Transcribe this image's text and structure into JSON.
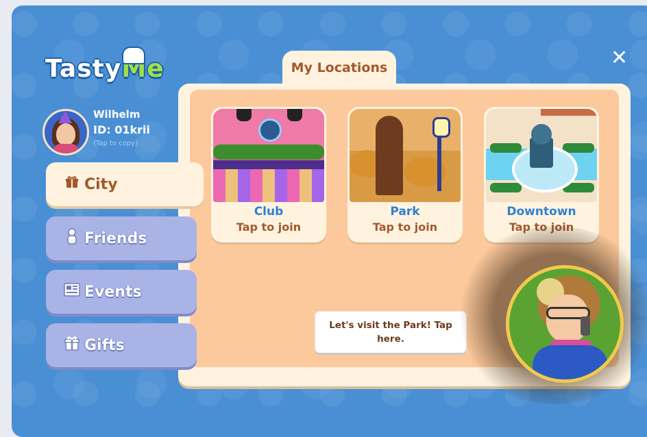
{
  "app": {
    "logo_part1": "Tasty",
    "logo_part2": "Me",
    "close_symbol": "✕"
  },
  "profile": {
    "name": "Wilhelm",
    "id": "ID: 01krii",
    "tap_hint": "(Tap to copy)"
  },
  "sidebar": {
    "tabs": [
      {
        "label": "City",
        "icon": "gift-box-icon",
        "glyph": "🎁",
        "active": true
      },
      {
        "label": "Friends",
        "icon": "person-icon",
        "glyph": "👤",
        "active": false
      },
      {
        "label": "Events",
        "icon": "newspaper-icon",
        "glyph": "📰",
        "active": false
      },
      {
        "label": "Gifts",
        "icon": "gift-icon",
        "glyph": "🎁",
        "active": false
      }
    ]
  },
  "main": {
    "tab_title": "My Locations",
    "locations": [
      {
        "name": "Club",
        "cta": "Tap to join"
      },
      {
        "name": "Park",
        "cta": "Tap to join"
      },
      {
        "name": "Downtown",
        "cta": "Tap to join"
      }
    ],
    "tooltip": "Let's visit the Park! Tap here."
  },
  "colors": {
    "background": "#4a8fd4",
    "panel": "#fff3df",
    "content": "#fcc99c",
    "accent_brown": "#a2592d",
    "accent_blue": "#2f7fd2",
    "tab_inactive": "#a9b3e6"
  }
}
